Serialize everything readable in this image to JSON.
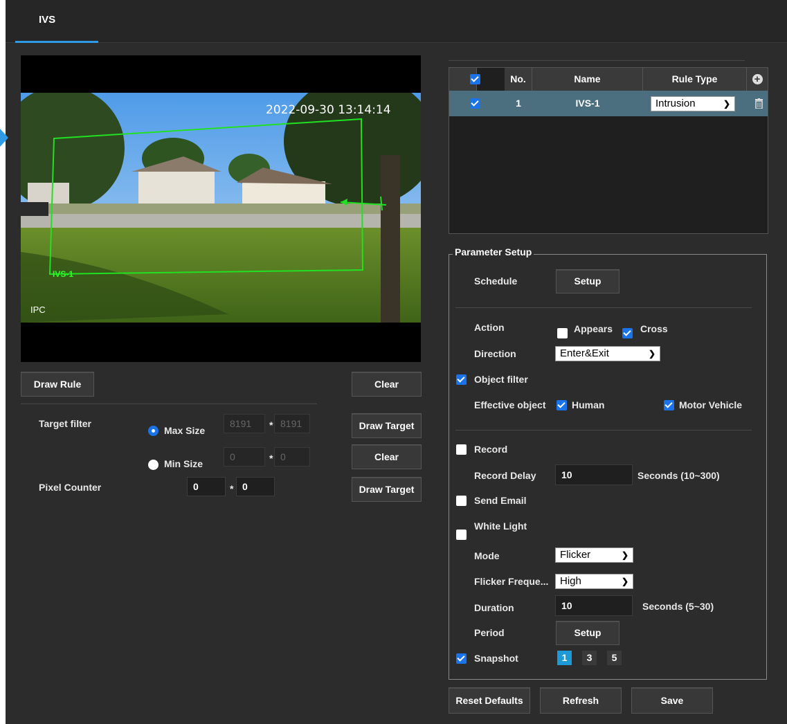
{
  "tab": {
    "label": "IVS"
  },
  "video": {
    "timestamp": "2022-09-30 13:14:14",
    "rule_label": "IVS-1",
    "channel_label": "IPC"
  },
  "left": {
    "draw_rule": "Draw Rule",
    "clear": "Clear",
    "target_filter_label": "Target filter",
    "max_size_label": "Max Size",
    "max_w": "8191",
    "max_h": "8191",
    "min_size_label": "Min Size",
    "min_w": "0",
    "min_h": "0",
    "draw_target": "Draw Target",
    "clear2": "Clear",
    "pixel_counter_label": "Pixel Counter",
    "pixel_w": "0",
    "pixel_h": "0",
    "draw_target2": "Draw Target",
    "times": "*"
  },
  "rules_table": {
    "headers": {
      "no": "No.",
      "name": "Name",
      "rule_type": "Rule Type"
    },
    "rows": [
      {
        "no": "1",
        "name": "IVS-1",
        "rule_type": "Intrusion"
      }
    ]
  },
  "param": {
    "legend": "Parameter Setup",
    "schedule_label": "Schedule",
    "setup": "Setup",
    "action_label": "Action",
    "appears": "Appears",
    "cross": "Cross",
    "direction_label": "Direction",
    "direction_value": "Enter&Exit",
    "object_filter": "Object filter",
    "effective_object_label": "Effective object",
    "human": "Human",
    "motor_vehicle": "Motor Vehicle",
    "record": "Record",
    "record_delay_label": "Record Delay",
    "record_delay_value": "10",
    "record_delay_unit": "Seconds (10~300)",
    "send_email": "Send Email",
    "white_light": "White Light",
    "mode_label": "Mode",
    "mode_value": "Flicker",
    "flicker_label": "Flicker Freque...",
    "flicker_value": "High",
    "duration_label": "Duration",
    "duration_value": "10",
    "duration_unit": "Seconds (5~30)",
    "period_label": "Period",
    "period_setup": "Setup",
    "snapshot": "Snapshot",
    "snapshot_options": [
      "1",
      "3",
      "5"
    ]
  },
  "footer": {
    "reset": "Reset Defaults",
    "refresh": "Refresh",
    "save": "Save"
  }
}
